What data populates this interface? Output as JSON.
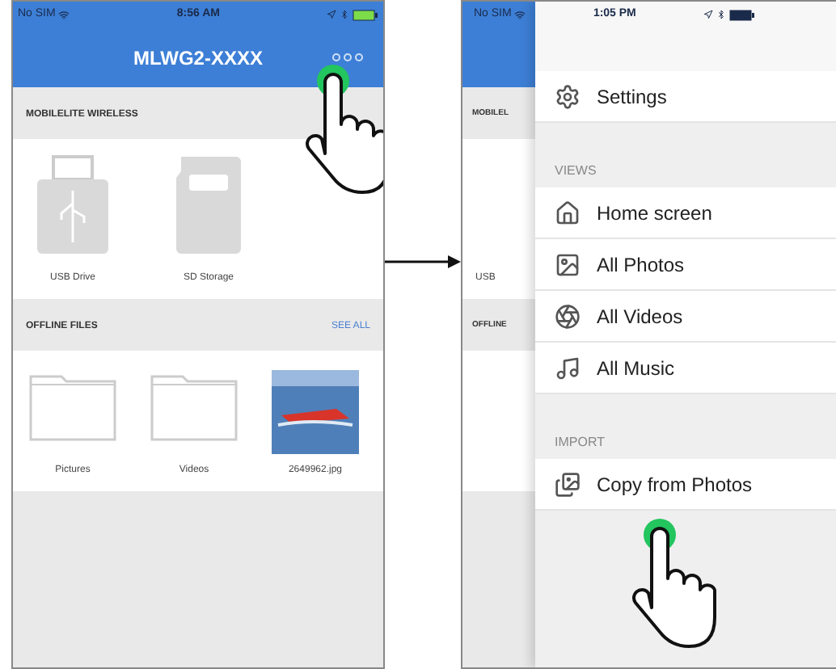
{
  "home_screen": {
    "status_bar": {
      "carrier": "No SIM",
      "time": "8:56 AM"
    },
    "title": "MLWG2-XXXX",
    "sections": [
      {
        "heading": "MOBILELITE WIRELESS",
        "items": [
          {
            "label": "USB Drive",
            "kind": "usb"
          },
          {
            "label": "SD Storage",
            "kind": "sd"
          }
        ]
      },
      {
        "heading": "OFFLINE FILES",
        "action": "SEE ALL",
        "items": [
          {
            "label": "Pictures",
            "kind": "folder"
          },
          {
            "label": "Videos",
            "kind": "folder"
          },
          {
            "label": "2649962.jpg",
            "kind": "photo"
          }
        ]
      }
    ]
  },
  "menu_screen": {
    "status_bar": {
      "carrier": "No SIM",
      "time": "1:05 PM"
    },
    "background_labels": [
      "MOBILEL",
      "USB",
      "OFFLINE"
    ],
    "groups": [
      {
        "items": [
          {
            "label": "Settings",
            "kind": "settings"
          }
        ]
      },
      {
        "heading": "VIEWS",
        "items": [
          {
            "label": "Home screen",
            "kind": "home"
          },
          {
            "label": "All Photos",
            "kind": "photos"
          },
          {
            "label": "All Videos",
            "kind": "videos"
          },
          {
            "label": "All Music",
            "kind": "music"
          }
        ]
      },
      {
        "heading": "IMPORT",
        "items": [
          {
            "label": "Copy from Photos",
            "kind": "copy"
          }
        ]
      }
    ]
  }
}
